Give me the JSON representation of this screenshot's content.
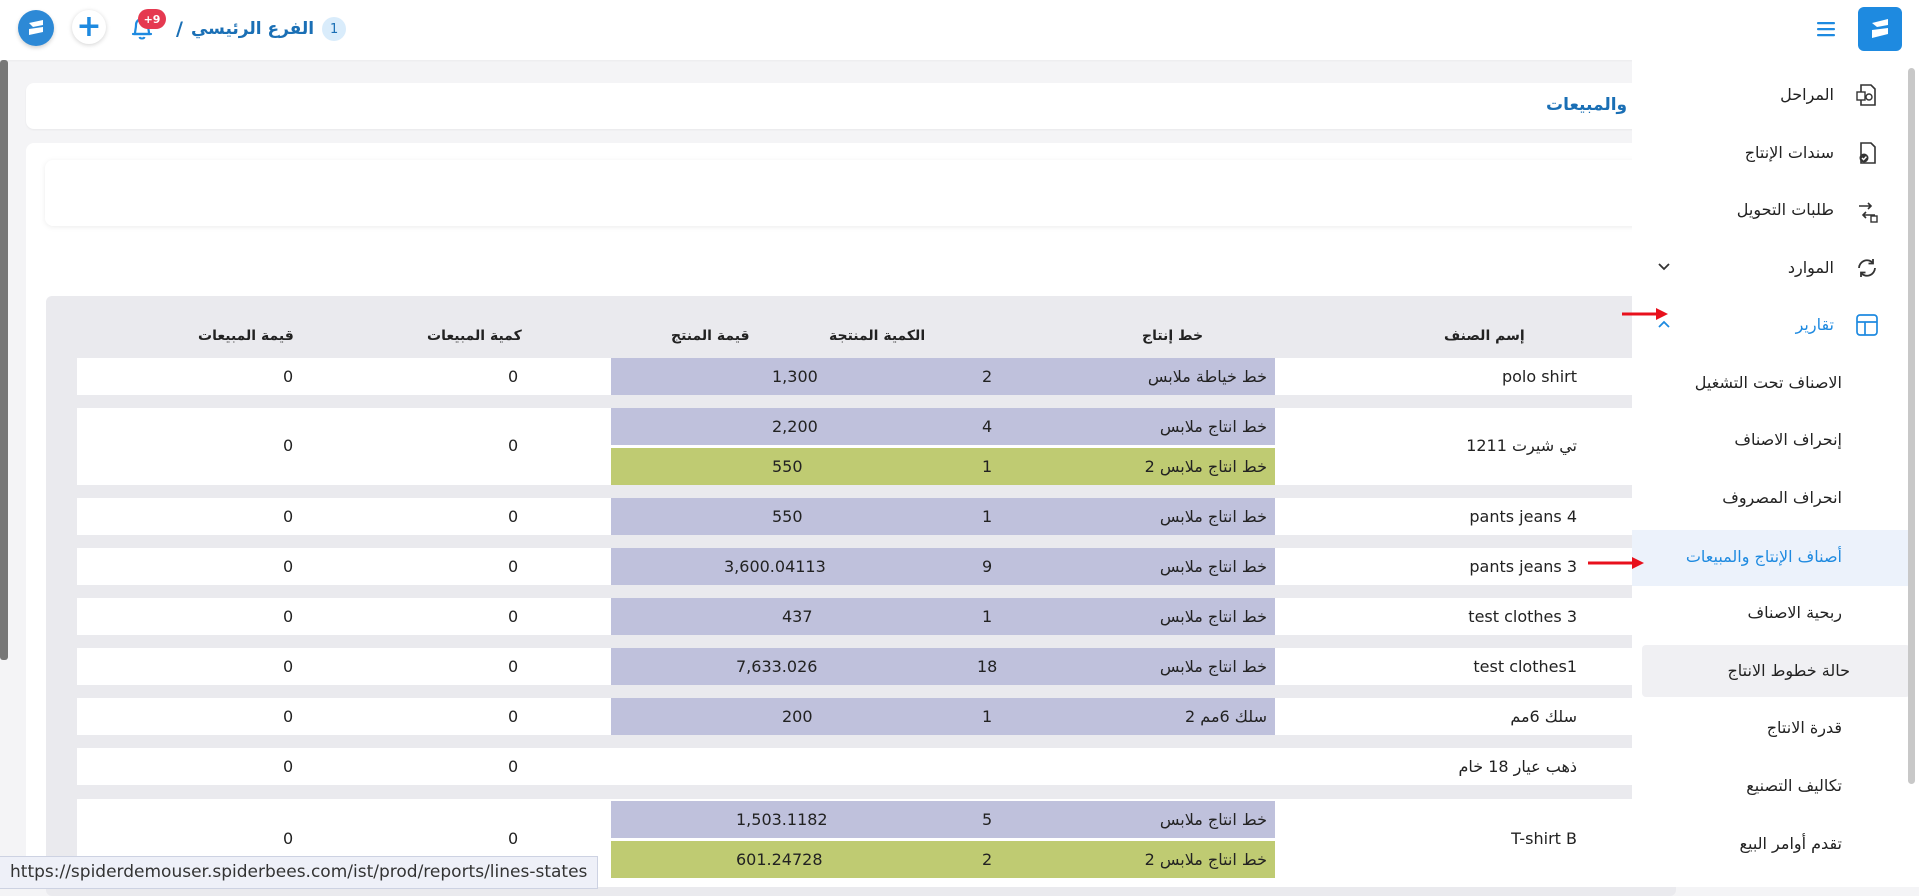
{
  "topbar": {
    "branch_number": "1",
    "branch_name": "الفرع الرئيسي",
    "separator": "/",
    "notification_badge": "+9",
    "plus_symbol": "+"
  },
  "page": {
    "title": "ج والمبيعات"
  },
  "table": {
    "headers": {
      "item_name": "إسم الصنف",
      "production_line": "خط إنتاج",
      "produced_qty": "الكمية المنتجة",
      "product_value": "قيمة المنتج",
      "sales_qty": "كمية المبيعات",
      "sales_value": "قيمة المبيعات"
    },
    "rows": [
      {
        "name": "polo shirt",
        "sales_qty": "0",
        "sales_value": "0",
        "lines": [
          {
            "line": "خط خياطة ملابس",
            "qty": "2",
            "value": "1,300"
          }
        ]
      },
      {
        "name": "تي شيرت 1211",
        "sales_qty": "0",
        "sales_value": "0",
        "lines": [
          {
            "line": "خط انتاج ملابس",
            "qty": "4",
            "value": "2,200"
          },
          {
            "line": "خط انتاج ملابس 2",
            "qty": "1",
            "value": "550"
          }
        ]
      },
      {
        "name": "pants jeans  4",
        "sales_qty": "0",
        "sales_value": "0",
        "lines": [
          {
            "line": "خط انتاج ملابس",
            "qty": "1",
            "value": "550"
          }
        ]
      },
      {
        "name": "pants jeans  3",
        "sales_qty": "0",
        "sales_value": "0",
        "lines": [
          {
            "line": "خط انتاج ملابس",
            "qty": "9",
            "value": "3,600.04113"
          }
        ]
      },
      {
        "name": "test clothes 3",
        "sales_qty": "0",
        "sales_value": "0",
        "lines": [
          {
            "line": "خط انتاج ملابس",
            "qty": "1",
            "value": "437"
          }
        ]
      },
      {
        "name": "test clothes1",
        "sales_qty": "0",
        "sales_value": "0",
        "lines": [
          {
            "line": "خط انتاج ملابس",
            "qty": "18",
            "value": "7,633.026"
          }
        ]
      },
      {
        "name": "سلك 6مم",
        "sales_qty": "0",
        "sales_value": "0",
        "lines": [
          {
            "line": "سلك 6مم 2",
            "qty": "1",
            "value": "200"
          }
        ]
      },
      {
        "name": "ذهب عيار 18 خام",
        "sales_qty": "0",
        "sales_value": "0",
        "lines": []
      },
      {
        "name": "T-shirt B",
        "sales_qty": "0",
        "sales_value": "0",
        "lines": [
          {
            "line": "خط انتاج ملابس",
            "qty": "5",
            "value": "1,503.1182"
          },
          {
            "line": "خط انتاج ملابس 2",
            "qty": "2",
            "value": "601.24728"
          }
        ]
      }
    ]
  },
  "sidebar": {
    "items": [
      {
        "label": "المراحل",
        "icon": "stages-icon"
      },
      {
        "label": "سندات الإنتاج",
        "icon": "production-voucher-icon"
      },
      {
        "label": "طلبات التحويل",
        "icon": "transfer-request-icon"
      },
      {
        "label": "الموارد",
        "icon": "resources-icon"
      },
      {
        "label": "تقارير",
        "icon": "reports-icon"
      }
    ],
    "sub_items": [
      {
        "label": "الاصناف تحت التشغيل"
      },
      {
        "label": "إنحراف الاصناف"
      },
      {
        "label": "انحراف المصروف"
      },
      {
        "label": "أصناف الإنتاج والمبيعات"
      },
      {
        "label": "ربحية الاصناف"
      },
      {
        "label": "حالة خطوط الانتاج"
      },
      {
        "label": "قدرة الانتاج"
      },
      {
        "label": "تكاليف التصنيع"
      },
      {
        "label": "تقدم أوامر البيع"
      }
    ]
  },
  "status_bar": {
    "url": "https://spiderdemouser.spiderbees.com/ist/prod/reports/lines-states"
  },
  "colors": {
    "accent": "#1e8ae0",
    "line_primary": "#bfc1dc",
    "line_secondary": "#bfcb72",
    "arrow": "#e8101c"
  }
}
